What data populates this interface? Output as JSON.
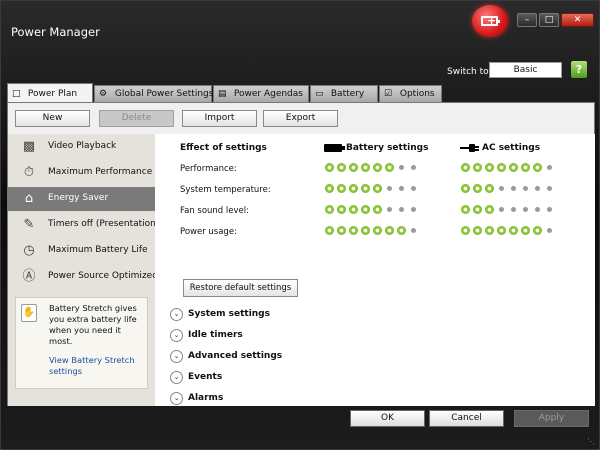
{
  "window": {
    "title": "Power Manager",
    "controls": {
      "minimize": "–",
      "maximize": "□",
      "close": "✕"
    },
    "logo_icon": "battery-plus-icon"
  },
  "switch_to": {
    "label": "Switch to:",
    "button": "Basic",
    "help_icon": "help-icon"
  },
  "tabs": [
    {
      "label": "Power Plan",
      "icon": "document-icon",
      "active": true
    },
    {
      "label": "Global Power Settings",
      "icon": "gear-icon"
    },
    {
      "label": "Power Agendas",
      "icon": "calendar-clock-icon"
    },
    {
      "label": "Battery",
      "icon": "battery-icon"
    },
    {
      "label": "Options",
      "icon": "checkbox-icon"
    }
  ],
  "toolbar": {
    "new": "New",
    "delete": "Delete",
    "import": "Import",
    "export": "Export"
  },
  "plans": [
    {
      "label": "Video Playback",
      "icon": "film-icon"
    },
    {
      "label": "Maximum Performance",
      "icon": "stopwatch-icon"
    },
    {
      "label": "Energy Saver",
      "icon": "house-icon",
      "active": true
    },
    {
      "label": "Timers off (Presentation)",
      "icon": "presentation-icon"
    },
    {
      "label": "Maximum Battery Life",
      "icon": "battery-clock-icon"
    },
    {
      "label": "Power Source Optimized",
      "icon": "power-source-icon"
    }
  ],
  "battery_stretch": {
    "text": "Battery Stretch gives you extra battery life when you need it most.",
    "link": "View Battery Stretch settings",
    "icon": "battery-stretch-icon"
  },
  "effects": {
    "title": "Effect of settings",
    "battery_header": "Battery settings",
    "ac_header": "AC settings",
    "total_dots": 8,
    "rows": [
      {
        "label": "Performance:",
        "battery_level": 6,
        "ac_level": 7
      },
      {
        "label": "System temperature:",
        "battery_level": 5,
        "ac_level": 3
      },
      {
        "label": "Fan sound level:",
        "battery_level": 5,
        "ac_level": 3
      },
      {
        "label": "Power usage:",
        "battery_level": 7,
        "ac_level": 7
      }
    ],
    "restore_button": "Restore default settings"
  },
  "sections": [
    "System settings",
    "Idle timers",
    "Advanced settings",
    "Events",
    "Alarms"
  ],
  "footer": {
    "ok": "OK",
    "cancel": "Cancel",
    "apply": "Apply"
  },
  "colors": {
    "accent_green": "#4d9a12",
    "selected_plan": "#7a7a7a",
    "close_red": "#c8281a"
  }
}
